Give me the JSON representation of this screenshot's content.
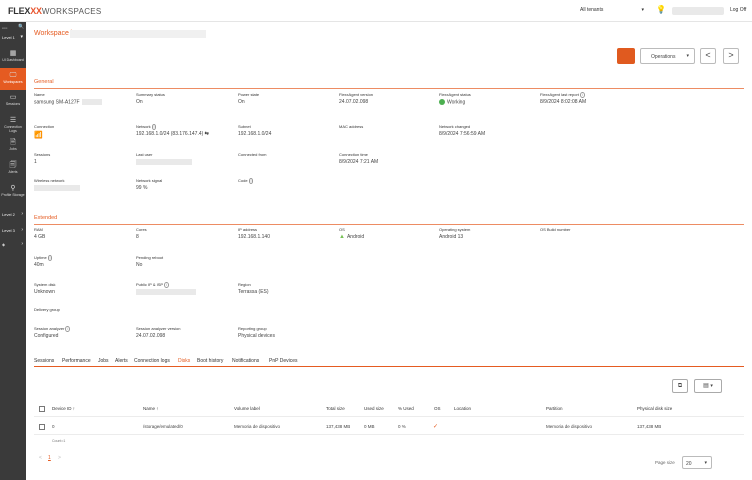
{
  "header": {
    "logo_text": "FLEX",
    "logo_accent": "XX",
    "logo_product": "WORKSPACES",
    "tenant_label": "All tenants",
    "logoff_label": "Log Off"
  },
  "sidebar": {
    "level1": "Level 1",
    "level2": "Level 2",
    "level3": "Level 3",
    "items": [
      {
        "label": "UI Dashboard",
        "icon": "dashboard-icon"
      },
      {
        "label": "Workspaces",
        "icon": "monitor-icon"
      },
      {
        "label": "Sessions",
        "icon": "sessions-icon"
      },
      {
        "label": "Connection Logs",
        "icon": "list-icon"
      },
      {
        "label": "Jobs",
        "icon": "jobs-icon"
      },
      {
        "label": "Alerts",
        "icon": "alert-icon"
      },
      {
        "label": "Profile Storage",
        "icon": "profile-icon"
      }
    ]
  },
  "breadcrumb": {
    "root": "Workspace \\"
  },
  "actions": {
    "operations_label": "Operations",
    "prev": "<",
    "next": ">"
  },
  "general": {
    "title": "General",
    "fields": {
      "name": {
        "label": "Name",
        "value": "samsung SM-A127F"
      },
      "summary_status": {
        "label": "Summary status",
        "value": "On"
      },
      "power_state": {
        "label": "Power state",
        "value": "On"
      },
      "flexagent_version": {
        "label": "FlexxAgent version",
        "value": "24.07.02.098"
      },
      "flexagent_status": {
        "label": "FlexxAgent status",
        "value": "Working"
      },
      "flexagent_last_report": {
        "label": "FlexxAgent last report",
        "value": "8/9/2024 8:02:08 AM"
      },
      "connection": {
        "label": "Connection",
        "value": ""
      },
      "network": {
        "label": "Network",
        "value": "192.168.1.0/24 (83.176.147.4)"
      },
      "subnet": {
        "label": "Subnet",
        "value": "192.168.1.0/24"
      },
      "mac": {
        "label": "MAC address",
        "value": ""
      },
      "network_changed": {
        "label": "Network changed",
        "value": "8/9/2024 7:56:59 AM"
      },
      "sessions": {
        "label": "Sessions",
        "value": "1"
      },
      "last_user": {
        "label": "Last user",
        "value": ""
      },
      "connected_from": {
        "label": "Connected from",
        "value": ""
      },
      "connection_time": {
        "label": "Connection time",
        "value": "8/9/2024 7:21 AM"
      },
      "wireless": {
        "label": "Wireless network",
        "value": ""
      },
      "network_signal": {
        "label": "Network signal",
        "value": "99 %"
      },
      "code": {
        "label": "Code",
        "value": ""
      }
    }
  },
  "extended": {
    "title": "Extended",
    "fields": {
      "ram": {
        "label": "RAM",
        "value": "4 GB"
      },
      "cores": {
        "label": "Cores",
        "value": "8"
      },
      "ip": {
        "label": "IP address",
        "value": "192.168.1.140"
      },
      "os": {
        "label": "OS",
        "value": "Android"
      },
      "operating_system": {
        "label": "Operating system",
        "value": "Android 13"
      },
      "os_build": {
        "label": "OS Build number",
        "value": ""
      },
      "uptime": {
        "label": "Uptime",
        "value": "40m"
      },
      "pending_reboot": {
        "label": "Pending reboot",
        "value": "No"
      },
      "system_disk": {
        "label": "System disk",
        "value": "Unknown"
      },
      "public_ip": {
        "label": "Public IP & ISP",
        "value": ""
      },
      "region": {
        "label": "Region",
        "value": "Terrassa (ES)"
      },
      "delivery_group": {
        "label": "Delivery group",
        "value": ""
      },
      "session_analyzer": {
        "label": "Session analyzer",
        "value": "Configured"
      },
      "session_analyzer_version": {
        "label": "Session analyzer version",
        "value": "24.07.02.098"
      },
      "reporting_group": {
        "label": "Reporting group",
        "value": "Physical devices"
      }
    }
  },
  "tabs": [
    "Sessions",
    "Performance",
    "Jobs",
    "Alerts",
    "Connection logs",
    "Disks",
    "Boot history",
    "Notifications",
    "PnP Devices"
  ],
  "active_tab": "Disks",
  "table": {
    "columns": [
      "Device ID",
      "Name",
      "Volume label",
      "Total size",
      "Used size",
      "% Used",
      "OS",
      "Location",
      "Partition",
      "Physical disk size"
    ],
    "rows": [
      {
        "device_id": "0",
        "name": "/storage/emulated/0",
        "volume_label": "Memoria de dispositivo",
        "total_size": "137,438 MB",
        "used_size": "0 MB",
        "pct_used": "0 %",
        "os": "✓",
        "location": "",
        "partition": "Memoria de dispositivo",
        "physical_size": "137,438 MB"
      }
    ],
    "count_label": "Count=1"
  },
  "pagination": {
    "prev": "<",
    "current": "1",
    "next": ">",
    "page_size_label": "Page size",
    "page_size": "20"
  },
  "colors": {
    "accent": "#e55b21",
    "sidebar": "#3a3a3a",
    "ok": "#4caf50"
  }
}
